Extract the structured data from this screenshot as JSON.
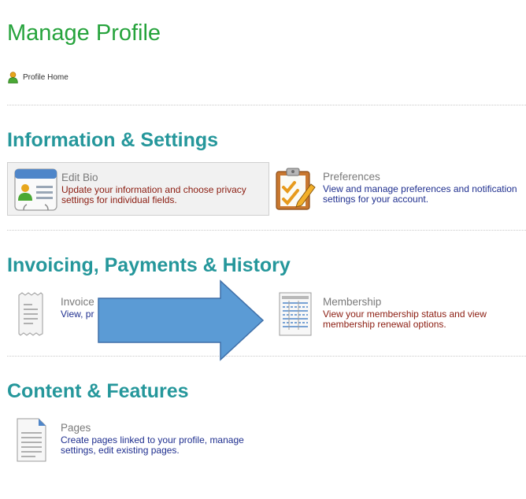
{
  "page": {
    "title": "Manage Profile"
  },
  "breadcrumb": {
    "profile_home": "Profile Home"
  },
  "sections": [
    {
      "title": "Information & Settings",
      "tiles": [
        {
          "title": "Edit Bio",
          "description": "Update your information and choose privacy settings for individual fields.",
          "icon": "contact-card-icon"
        },
        {
          "title": "Preferences",
          "description": "View and manage preferences and notification settings for your account.",
          "icon": "clipboard-checklist-icon"
        }
      ]
    },
    {
      "title": "Invoicing, Payments & History",
      "tiles": [
        {
          "title": "Invoice",
          "description": "View, pr",
          "icon": "receipt-icon"
        },
        {
          "title": "Membership",
          "description": "View your membership status and view membership renewal options.",
          "icon": "spreadsheet-icon"
        }
      ]
    },
    {
      "title": "Content & Features",
      "tiles": [
        {
          "title": "Pages",
          "description": "Create pages linked to your profile, manage settings, edit existing pages.",
          "icon": "document-icon"
        }
      ]
    }
  ],
  "annotation": {
    "shape": "right-arrow",
    "color": "#5b9bd5",
    "border": "#3f6fa8"
  },
  "colors": {
    "title_green": "#26a33c",
    "section_teal": "#25979b",
    "link_blue": "#1f2f8f",
    "link_red": "#8b1c10"
  }
}
